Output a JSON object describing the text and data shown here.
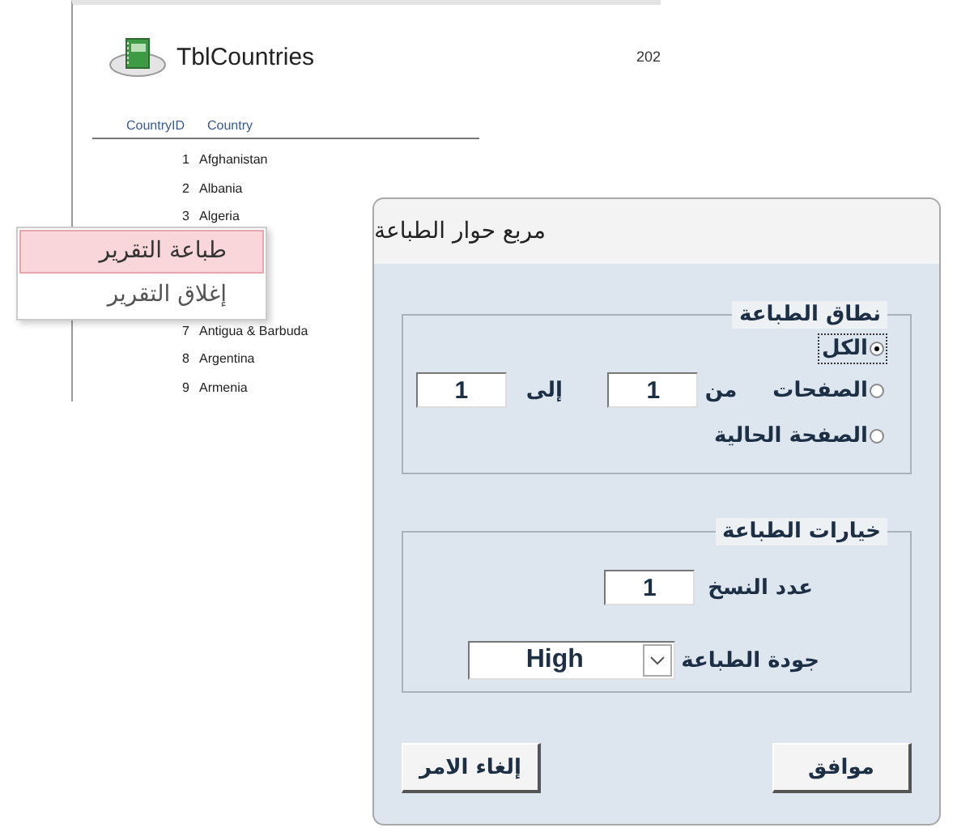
{
  "report": {
    "title": "TblCountries",
    "date": "202",
    "id_column_header": "CountryID",
    "country_column_header": "Country",
    "rows": [
      {
        "id": "1",
        "country": "Afghanistan"
      },
      {
        "id": "2",
        "country": "Albania"
      },
      {
        "id": "3",
        "country": "Algeria"
      },
      {
        "id": "7",
        "country": "Antigua & Barbuda"
      },
      {
        "id": "8",
        "country": "Argentina"
      },
      {
        "id": "9",
        "country": "Armenia"
      }
    ]
  },
  "context_menu": {
    "items": [
      {
        "label": "طباعة التقرير",
        "selected": true
      },
      {
        "label": "إغلاق التقرير",
        "selected": false
      }
    ]
  },
  "dialog": {
    "title": "مربع حوار الطباعة",
    "range_group": {
      "legend": "نطاق الطباعة",
      "options": [
        {
          "label": "الكل",
          "selected": true
        },
        {
          "label": "الصفحات",
          "selected": false
        },
        {
          "label": "الصفحة الحالية",
          "selected": false
        }
      ],
      "from_label": "من",
      "from_value": "1",
      "to_label": "إلى",
      "to_value": "1"
    },
    "options_group": {
      "legend": "خيارات الطباعة",
      "copies_label": "عدد النسخ",
      "copies_value": "1",
      "quality_label": "جودة الطباعة",
      "quality_value": "High"
    },
    "buttons": [
      {
        "label": "موافق"
      },
      {
        "label": "إلغاء الامر"
      }
    ]
  }
}
